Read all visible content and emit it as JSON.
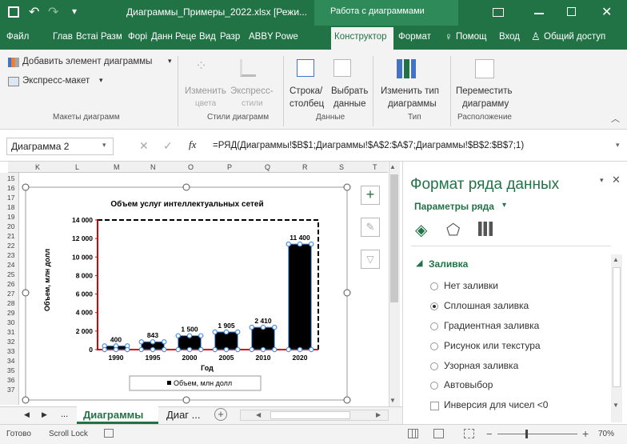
{
  "titlebar": {
    "filename": "Диаграммы_Примеры_2022.xlsx [Режи...",
    "context": "Работа с диаграммами",
    "colors": {
      "bar": "#217346"
    }
  },
  "tabs": [
    "Файл",
    "Глав",
    "Встаі",
    "Разм",
    "Форі",
    "Данн",
    "Реце",
    "Вид",
    "Разр",
    "ABBY",
    "Powe",
    "Конструктор",
    "Формат"
  ],
  "tab_help": "Помощ",
  "tab_login": "Вход",
  "tab_share": "Общий доступ",
  "ribbon": {
    "add_element": "Добавить элемент диаграммы",
    "express_layout": "Экспресс-макет",
    "group_layouts": "Макеты диаграмм",
    "change_colors_1": "Изменить",
    "change_colors_2": "цвета",
    "express_styles_1": "Экспресс-",
    "express_styles_2": "стили",
    "group_styles": "Стили диаграмм",
    "row_col_1": "Строка/",
    "row_col_2": "столбец",
    "select_data_1": "Выбрать",
    "select_data_2": "данные",
    "group_data": "Данные",
    "change_type_1": "Изменить тип",
    "change_type_2": "диаграммы",
    "group_type": "Тип",
    "move_1": "Переместить",
    "move_2": "диаграмму",
    "group_location": "Расположение"
  },
  "formula": {
    "namebox": "Диаграмма 2",
    "fx": "fx",
    "formula": "=РЯД(Диаграммы!$B$1;Диаграммы!$A$2:$A$7;Диаграммы!$B$2:$B$7;1)"
  },
  "sheet": {
    "columns": [
      "K",
      "L",
      "M",
      "N",
      "O",
      "P",
      "Q",
      "R",
      "S",
      "T"
    ],
    "rows": [
      "15",
      "16",
      "17",
      "18",
      "19",
      "20",
      "21",
      "22",
      "23",
      "24",
      "25",
      "26",
      "27",
      "28",
      "29",
      "30",
      "31",
      "32",
      "33",
      "34",
      "35",
      "36",
      "37"
    ]
  },
  "chart_data": {
    "type": "bar",
    "title": "Объем услуг интеллектуальных сетей",
    "xlabel": "Год",
    "ylabel": "Объем, млн долл",
    "categories": [
      "1990",
      "1995",
      "2000",
      "2005",
      "2010",
      "2020"
    ],
    "series": [
      {
        "name": "Объем, млн долл",
        "values": [
          400,
          843,
          1500,
          1905,
          2410,
          11400
        ]
      }
    ],
    "data_labels": [
      "400",
      "843",
      "1 500",
      "1 905",
      "2 410",
      "11 400"
    ],
    "yticks": [
      "0",
      "2 000",
      "4 000",
      "6 000",
      "8 000",
      "10 000",
      "12 000",
      "14 000"
    ],
    "ylim": [
      0,
      14000
    ],
    "grid": false,
    "legend": "bottom",
    "colors": {
      "bar": "#000000",
      "axis": "#e00000",
      "handle": "#4a90e2"
    }
  },
  "pane": {
    "title": "Формат ряда данных",
    "subtitle": "Параметры ряда",
    "section": "Заливка",
    "options": [
      "Нет заливки",
      "Сплошная заливка",
      "Градиентная заливка",
      "Рисунок или текстура",
      "Узорная заливка",
      "Автовыбор",
      "Инверсия для чисел <0"
    ],
    "selected": "Сплошная заливка"
  },
  "sheettabs": {
    "active": "Диаграммы",
    "other": "Диаг ...",
    "more": "..."
  },
  "status": {
    "ready": "Готово",
    "scroll_lock": "Scroll Lock",
    "zoom": "70%"
  }
}
